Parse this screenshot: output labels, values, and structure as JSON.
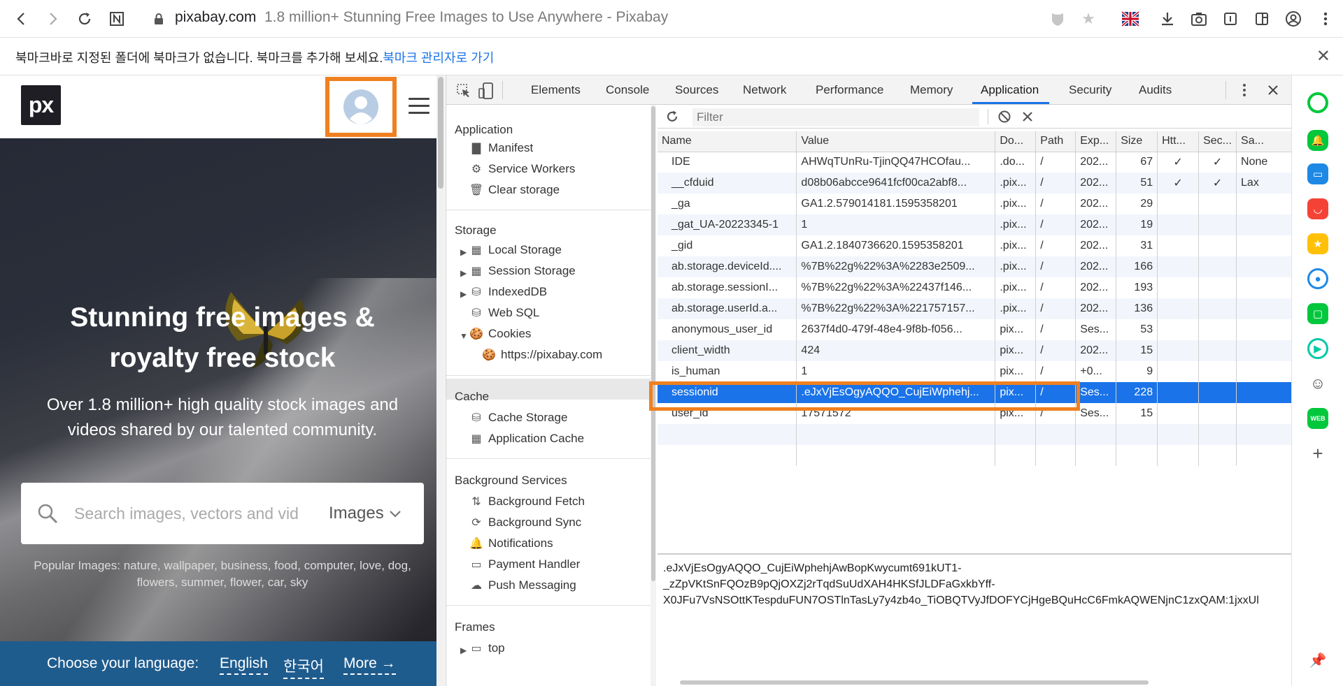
{
  "browser": {
    "url_domain": "pixabay.com",
    "url_title": "1.8 million+ Stunning Free Images to Use Anywhere - Pixabay",
    "lang_flag_icon": "uk-flag-icon"
  },
  "bookmark_bar": {
    "message": "북마크바로 지정된 폴더에 북마크가 없습니다. 북마크를 추가해 보세요.",
    "link": "북마크 관리자로 가기"
  },
  "pixabay": {
    "logo": "px",
    "hero_title_line1": "Stunning free images &",
    "hero_title_line2": "royalty free stock",
    "hero_sub": "Over 1.8 million+ high quality stock images and videos shared by our talented community.",
    "search_placeholder": "Search images, vectors and videos",
    "search_type": "Images",
    "popular": "Popular Images: nature, wallpaper, business, food, computer, love, dog, flowers, summer, flower, car, sky",
    "lang_label": "Choose your language:",
    "lang_en": "English",
    "lang_ko": "한국어",
    "lang_more": "More →"
  },
  "devtools": {
    "tabs": [
      "Elements",
      "Console",
      "Sources",
      "Network",
      "Performance",
      "Memory",
      "Application",
      "Security",
      "Audits"
    ],
    "active_tab": "Application",
    "sidebar": {
      "application_header": "Application",
      "application_items": [
        "Manifest",
        "Service Workers",
        "Clear storage"
      ],
      "storage_header": "Storage",
      "storage_items": [
        "Local Storage",
        "Session Storage",
        "IndexedDB",
        "Web SQL",
        "Cookies"
      ],
      "cookie_origin": "https://pixabay.com",
      "cache_header": "Cache",
      "cache_items": [
        "Cache Storage",
        "Application Cache"
      ],
      "bg_header": "Background Services",
      "bg_items": [
        "Background Fetch",
        "Background Sync",
        "Notifications",
        "Payment Handler",
        "Push Messaging"
      ],
      "frames_header": "Frames",
      "frames_item": "top"
    },
    "filter_placeholder": "Filter",
    "columns": [
      "Name",
      "Value",
      "Do...",
      "Path",
      "Exp...",
      "Size",
      "Htt...",
      "Sec...",
      "Sa..."
    ],
    "rows": [
      [
        "IDE",
        "AHWqTUnRu-TjinQQ47HCOfau...",
        ".do...",
        "/",
        "202...",
        "67",
        "✓",
        "✓",
        "None"
      ],
      [
        "__cfduid",
        "d08b06abcce9641fcf00ca2abf8...",
        ".pix...",
        "/",
        "202...",
        "51",
        "✓",
        "✓",
        "Lax"
      ],
      [
        "_ga",
        "GA1.2.579014181.1595358201",
        ".pix...",
        "/",
        "202...",
        "29",
        "",
        "",
        ""
      ],
      [
        "_gat_UA-20223345-1",
        "1",
        ".pix...",
        "/",
        "202...",
        "19",
        "",
        "",
        ""
      ],
      [
        "_gid",
        "GA1.2.1840736620.1595358201",
        ".pix...",
        "/",
        "202...",
        "31",
        "",
        "",
        ""
      ],
      [
        "ab.storage.deviceId....",
        "%7B%22g%22%3A%2283e2509...",
        ".pix...",
        "/",
        "202...",
        "166",
        "",
        "",
        ""
      ],
      [
        "ab.storage.sessionI...",
        "%7B%22g%22%3A%22437f146...",
        ".pix...",
        "/",
        "202...",
        "193",
        "",
        "",
        ""
      ],
      [
        "ab.storage.userId.a...",
        "%7B%22g%22%3A%221757157...",
        ".pix...",
        "/",
        "202...",
        "136",
        "",
        "",
        ""
      ],
      [
        "anonymous_user_id",
        "2637f4d0-479f-48e4-9f8b-f056...",
        "pix...",
        "/",
        "Ses...",
        "53",
        "",
        "",
        ""
      ],
      [
        "client_width",
        "424",
        "pix...",
        "/",
        "202...",
        "15",
        "",
        "",
        ""
      ],
      [
        "is_human",
        "1",
        "pix...",
        "/",
        "+0...",
        "9",
        "",
        "",
        ""
      ],
      [
        "sessionid",
        ".eJxVjEsOgyAQQO_CujEiWphehj...",
        "pix...",
        "/",
        "Ses...",
        "228",
        "",
        "",
        ""
      ],
      [
        "user_id",
        "17571572",
        "pix...",
        "/",
        "Ses...",
        "15",
        "",
        "",
        ""
      ]
    ],
    "selected_row": 11,
    "value_preview_line1": ".eJxVjEsOgyAQQO_CujEiWphehjAwBopKwycumt691kUT1-",
    "value_preview_line2": "_zZpVKtSnFQOzB9pQjOXZj2rTqdSuUdXAH4HKSfJLDFaGxkbYff-",
    "value_preview_line3": "X0JFu7VsNSOttKTespduFUN7OSTlnTasLy7y4zb4o_TiOBQTVyJfDOFYCjHgeBQuHcC6FmkAQWENjnC1zxQAM:1jxxUl"
  }
}
